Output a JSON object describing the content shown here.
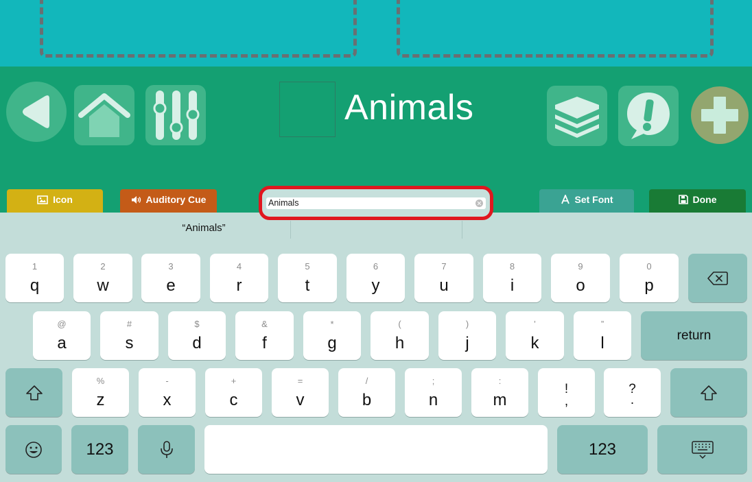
{
  "header": {
    "title": "Animals",
    "icons": [
      "back-arrow-icon",
      "home-icon",
      "sliders-icon",
      "layers-icon",
      "alert-speech-icon",
      "add-plus-icon"
    ]
  },
  "toolbar": {
    "icon_label": "Icon",
    "auditory_cue_label": "Auditory Cue",
    "set_font_label": "Set Font",
    "done_label": "Done"
  },
  "name_field": {
    "value": "Animals"
  },
  "suggestions": [
    "“Animals”",
    "",
    ""
  ],
  "keyboard": {
    "row1": [
      {
        "sub": "1",
        "main": "q"
      },
      {
        "sub": "2",
        "main": "w"
      },
      {
        "sub": "3",
        "main": "e"
      },
      {
        "sub": "4",
        "main": "r"
      },
      {
        "sub": "5",
        "main": "t"
      },
      {
        "sub": "6",
        "main": "y"
      },
      {
        "sub": "7",
        "main": "u"
      },
      {
        "sub": "8",
        "main": "i"
      },
      {
        "sub": "9",
        "main": "o"
      },
      {
        "sub": "0",
        "main": "p"
      }
    ],
    "row2": [
      {
        "sub": "@",
        "main": "a"
      },
      {
        "sub": "#",
        "main": "s"
      },
      {
        "sub": "$",
        "main": "d"
      },
      {
        "sub": "&",
        "main": "f"
      },
      {
        "sub": "*",
        "main": "g"
      },
      {
        "sub": "(",
        "main": "h"
      },
      {
        "sub": ")",
        "main": "j"
      },
      {
        "sub": "’",
        "main": "k"
      },
      {
        "sub": "”",
        "main": "l"
      }
    ],
    "row3": [
      {
        "sub": "%",
        "main": "z"
      },
      {
        "sub": "-",
        "main": "x"
      },
      {
        "sub": "+",
        "main": "c"
      },
      {
        "sub": "=",
        "main": "v"
      },
      {
        "sub": "/",
        "main": "b"
      },
      {
        "sub": ";",
        "main": "n"
      },
      {
        "sub": ":",
        "main": "m"
      },
      {
        "sub": "!",
        "main": ","
      },
      {
        "sub": "?",
        "main": "."
      }
    ],
    "return_label": "return",
    "numbers_label": "123",
    "colors": {
      "key": "#ffffff",
      "dark_key": "#8cc1bb",
      "background": "#c3ddd9"
    }
  },
  "colors": {
    "top_strip": "#12b7bb",
    "header": "#14a072",
    "icon_button": "#d3b114",
    "auditory_button": "#c45b18",
    "set_font_button": "#3aa393",
    "done_button": "#197b35",
    "highlight": "#e0171f"
  }
}
